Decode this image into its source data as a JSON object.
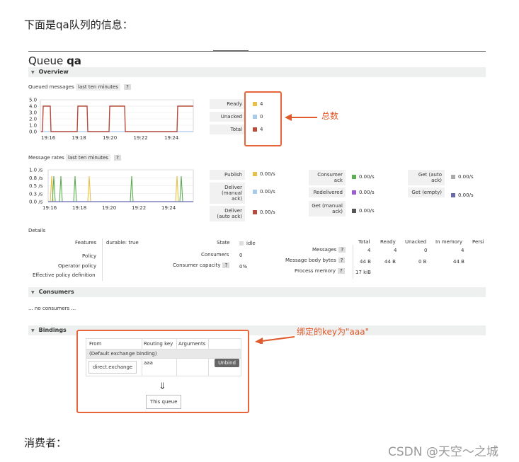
{
  "intro_text": "下面是qa队列的信息：",
  "footer_text": "消费者：",
  "watermark": "CSDN @天空～之城",
  "queue": {
    "title_prefix": "Queue",
    "name": "qa"
  },
  "overview": {
    "section_label": "Overview",
    "queued_messages": {
      "label": "Queued messages",
      "range_label": "last ten minutes",
      "help": "?",
      "y_ticks": [
        "5.0",
        "4.0",
        "3.0",
        "2.0",
        "1.0",
        "0.0"
      ],
      "x_ticks": [
        "19:16",
        "19:18",
        "19:20",
        "19:22",
        "19:24"
      ],
      "legend": [
        {
          "label": "Ready",
          "value": "4",
          "color": "#e8c048"
        },
        {
          "label": "Unacked",
          "value": "0",
          "color": "#a9cbea"
        },
        {
          "label": "Total",
          "value": "4",
          "color": "#b74b3c"
        }
      ]
    },
    "message_rates": {
      "label": "Message rates",
      "range_label": "last ten minutes",
      "help": "?",
      "y_ticks": [
        "1.0 /s",
        "0.8 /s",
        "0.5 /s",
        "0.3 /s",
        "0.0 /s"
      ],
      "x_ticks": [
        "19:16",
        "19:18",
        "19:20",
        "19:22",
        "19:24"
      ],
      "col1": [
        {
          "label": "Publish",
          "value": "0.00/s",
          "color": "#e8c048"
        },
        {
          "label": "Deliver (manual ack)",
          "value": "0.00/s",
          "color": "#a9cbea"
        },
        {
          "label": "Deliver (auto ack)",
          "value": "0.00/s",
          "color": "#b74b3c"
        }
      ],
      "col2": [
        {
          "label": "Consumer ack",
          "value": "0.00/s",
          "color": "#5cae52"
        },
        {
          "label": "Redelivered",
          "value": "0.00/s",
          "color": "#9c5bd6"
        },
        {
          "label": "Get (manual ack)",
          "value": "0.00/s",
          "color": "#555555"
        }
      ],
      "col3": [
        {
          "label": "Get (auto ack)",
          "value": "0.00/s",
          "color": "#aaaaaa"
        },
        {
          "label": "Get (empty)",
          "value": "0.00/s",
          "color": "#6a6ab0"
        }
      ]
    },
    "annotation_total": "总数"
  },
  "details": {
    "label": "Details",
    "features_label": "Features",
    "features_key": "durable:",
    "features_value": "true",
    "policy_label": "Policy",
    "operator_policy_label": "Operator policy",
    "effective_policy_label": "Effective policy definition",
    "state_label": "State",
    "state_value": "idle",
    "consumers_label": "Consumers",
    "consumers_value": "0",
    "consumer_capacity_label": "Consumer capacity",
    "consumer_capacity_value": "0%",
    "help": "?",
    "table_headers": [
      "Total",
      "Ready",
      "Unacked",
      "In memory",
      "Persi"
    ],
    "rows": [
      {
        "label": "Messages",
        "values": [
          "4",
          "4",
          "0",
          "4"
        ]
      },
      {
        "label": "Message body bytes",
        "values": [
          "44 B",
          "44 B",
          "0 B",
          "44 B"
        ]
      },
      {
        "label": "Process memory",
        "values": [
          "17 kiB"
        ]
      }
    ]
  },
  "consumers": {
    "section_label": "Consumers",
    "empty_text": "... no consumers ..."
  },
  "bindings": {
    "section_label": "Bindings",
    "headers": [
      "From",
      "Routing key",
      "Arguments"
    ],
    "default_row": "(Default exchange binding)",
    "row": {
      "from": "direct.exchange",
      "routing_key": "aaa",
      "unbind": "Unbind"
    },
    "arrow": "⇓",
    "this_queue": "This queue",
    "annotation": "绑定的key为\"aaa\""
  }
}
